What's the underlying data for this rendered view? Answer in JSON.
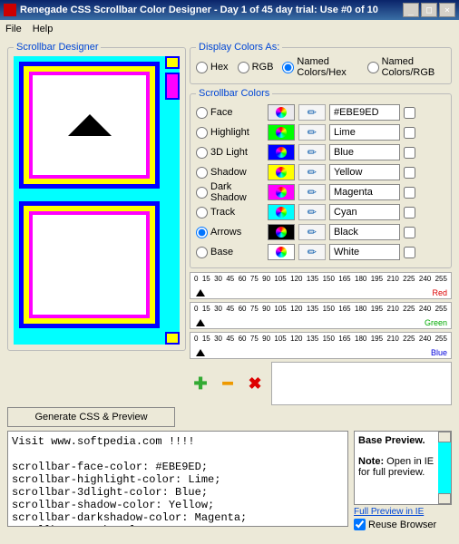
{
  "window": {
    "title": "Renegade CSS Scrollbar Color Designer - Day 1 of 45 day trial: Use #0 of 10"
  },
  "menu": {
    "file": "File",
    "help": "Help"
  },
  "designer": {
    "legend": "Scrollbar Designer"
  },
  "displayAs": {
    "legend": "Display Colors As:",
    "hex": "Hex",
    "rgb": "RGB",
    "namedHex": "Named Colors/Hex",
    "namedRgb": "Named Colors/RGB"
  },
  "colors": {
    "legend": "Scrollbar Colors",
    "rows": [
      {
        "label": "Face",
        "swatch": "#EBE9ED",
        "value": "#EBE9ED"
      },
      {
        "label": "Highlight",
        "swatch": "#00ff00",
        "value": "Lime"
      },
      {
        "label": "3D Light",
        "swatch": "#0000ff",
        "value": "Blue"
      },
      {
        "label": "Shadow",
        "swatch": "#ffff00",
        "value": "Yellow"
      },
      {
        "label": "Dark Shadow",
        "swatch": "#ff00ff",
        "value": "Magenta"
      },
      {
        "label": "Track",
        "swatch": "#00ffff",
        "value": "Cyan"
      },
      {
        "label": "Arrows",
        "swatch": "#000000",
        "value": "Black"
      },
      {
        "label": "Base",
        "swatch": "#ffffff",
        "value": "White"
      }
    ]
  },
  "sliders": {
    "ticks": [
      "0",
      "15",
      "30",
      "45",
      "60",
      "75",
      "90",
      "105",
      "120",
      "135",
      "150",
      "165",
      "180",
      "195",
      "210",
      "225",
      "240",
      "255"
    ],
    "red": "Red",
    "green": "Green",
    "blue": "Blue"
  },
  "buttons": {
    "generate": "Generate CSS & Preview"
  },
  "output": "Visit www.softpedia.com !!!!\n\nscrollbar-face-color: #EBE9ED;\nscrollbar-highlight-color: Lime;\nscrollbar-3dlight-color: Blue;\nscrollbar-shadow-color: Yellow;\nscrollbar-darkshadow-color: Magenta;\nscrollbar-track-color: Cyan;",
  "preview": {
    "title": "Base Preview.",
    "note_label": "Note:",
    "note": " Open in IE for full preview.",
    "link": "Full Preview in IE",
    "reuse": "Reuse Browser"
  }
}
